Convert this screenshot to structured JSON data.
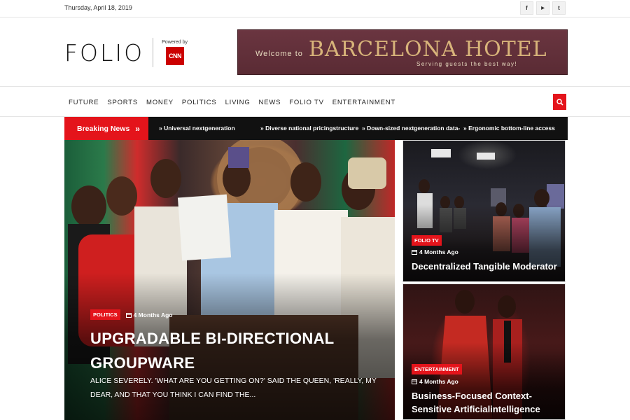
{
  "topbar": {
    "date": "Thursday, April 18, 2019",
    "social": [
      {
        "icon": "facebook-icon",
        "glyph": "f"
      },
      {
        "icon": "youtube-icon",
        "glyph": "▶"
      },
      {
        "icon": "twitter-icon",
        "glyph": "t"
      }
    ]
  },
  "header": {
    "logo": "FOLIO",
    "powered_by": "Powered by",
    "partner_logo": "CNN",
    "banner": {
      "welcome": "Welcome to",
      "hotel": "BARCELONA HOTEL",
      "tagline": "Serving guests the best way!"
    }
  },
  "nav": {
    "items": [
      "FUTURE",
      "SPORTS",
      "MONEY",
      "POLITICS",
      "LIVING",
      "NEWS",
      "FOLIO TV",
      "ENTERTAINMENT"
    ],
    "search_icon": "search-icon"
  },
  "breaking": {
    "label": "Breaking News",
    "items": [
      "» Universal nextgeneration",
      "» Diverse national pricingstructure",
      "» Down-sized nextgeneration data-",
      "» Ergonomic bottom-line access"
    ]
  },
  "feature": {
    "category": "POLITICS",
    "time": "4 Months Ago",
    "title": "UPGRADABLE BI-DIRECTIONAL GROUPWARE",
    "excerpt": "ALICE SEVERELY. 'WHAT ARE YOU GETTING ON?' SAID THE QUEEN, 'REALLY, MY DEAR, AND THAT YOU THINK I CAN FIND THE..."
  },
  "side": [
    {
      "category": "FOLIO TV",
      "time": "4 Months Ago",
      "title": "Decentralized Tangible Moderator"
    },
    {
      "category": "ENTERTAINMENT",
      "time": "4 Months Ago",
      "title": "Business-Focused Context-Sensitive Artificialintelligence"
    }
  ],
  "colors": {
    "accent": "#e4141b",
    "dark": "#111111"
  }
}
